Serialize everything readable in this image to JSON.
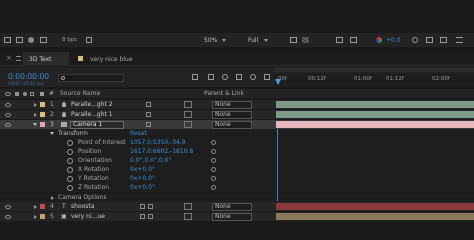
{
  "top_toolbar": {
    "fps_label": "8 bpc",
    "zoom": "50%",
    "resolution": "Full",
    "exposure": "+0.0"
  },
  "tabs": {
    "active": "3D Text",
    "other": "very nice blue"
  },
  "timecode": {
    "main": "0:00:00:00",
    "sub": "00000 (24.00 fps)"
  },
  "columns": {
    "source_name": "Source Name",
    "parent_link": "Parent & Link"
  },
  "ruler": {
    "ticks": [
      "00f",
      "00:12f",
      "01:00f",
      "01:12f",
      "02:00f"
    ]
  },
  "layers": [
    {
      "num": "1",
      "name": "Paralle...ght 2",
      "parent": "None",
      "color": "#d8c07a"
    },
    {
      "num": "2",
      "name": "Paralle...ght 1",
      "parent": "None",
      "color": "#d8c07a"
    },
    {
      "num": "3",
      "name": "Camera 1",
      "parent": "None",
      "color": "#e4a4b0"
    }
  ],
  "transform": {
    "group_label": "Transform",
    "reset_label": "Reset",
    "props": [
      {
        "name": "Point of Interest",
        "value": "1057.0,5350,-34.9"
      },
      {
        "name": "Position",
        "value": "1617.0,6602,-1810.8"
      },
      {
        "name": "Orientation",
        "value": "0.0°,0.0°,0.0°"
      },
      {
        "name": "X Rotation",
        "value": "0x+0.0°"
      },
      {
        "name": "Y Rotation",
        "value": "0x+0.0°"
      },
      {
        "name": "Z Rotation",
        "value": "0x+0.0°"
      }
    ]
  },
  "camera_options": {
    "label": "Camera Options"
  },
  "bottom_layers": [
    {
      "num": "4",
      "name": "shoosta",
      "parent": "None",
      "color": "#c84a4a",
      "type_glyph": "T"
    },
    {
      "num": "5",
      "name": "very ni...ue",
      "parent": "None",
      "color": "#c8a06a",
      "type_glyph": "▣"
    }
  ],
  "colors": {
    "accent_blue": "#3a8fd6",
    "bar_green": "#7e9a8a",
    "bar_pink": "#e7b7bf",
    "bar_red": "#8a3a3a",
    "bar_tan": "#8a7a5a"
  }
}
